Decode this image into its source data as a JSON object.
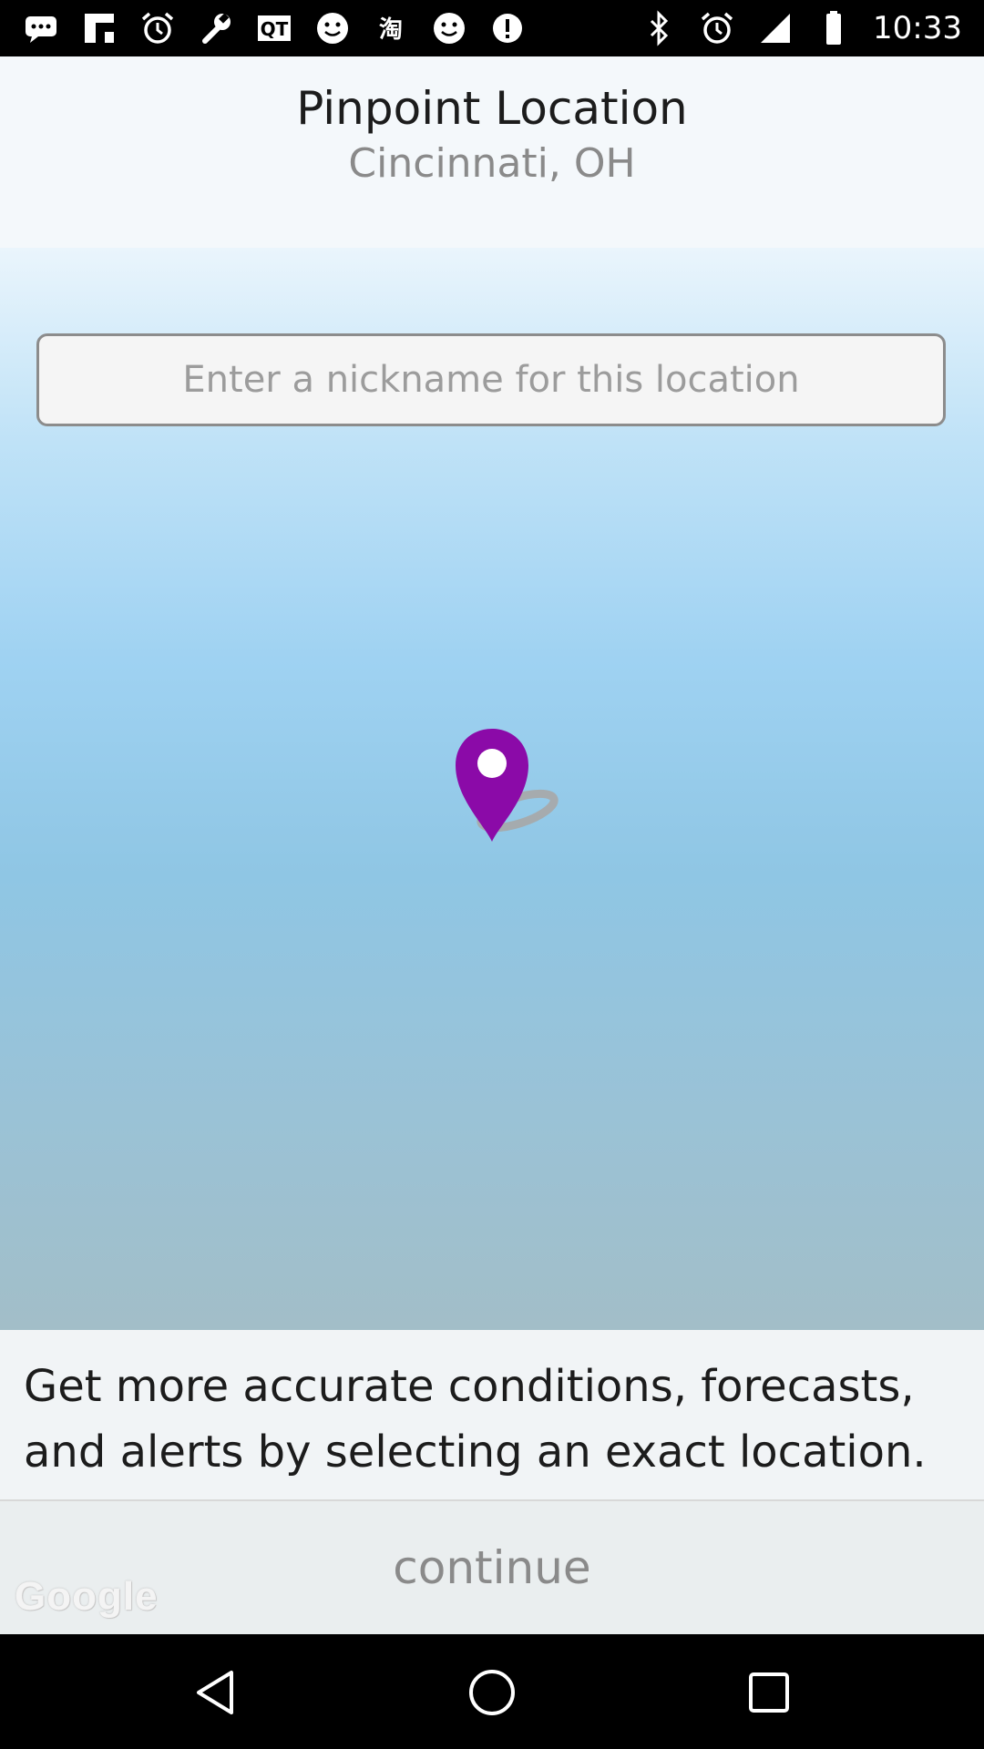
{
  "status_bar": {
    "time": "10:33",
    "left_icons": [
      "messages-icon",
      "flipboard-icon",
      "alarm-icon",
      "wrench-icon",
      "qt-icon",
      "smiley-icon",
      "translate-icon",
      "smiley-icon",
      "info-icon"
    ],
    "right_icons": [
      "bluetooth-icon",
      "alarm-icon",
      "signal-icon",
      "battery-icon"
    ]
  },
  "header": {
    "title": "Pinpoint Location",
    "subtitle": "Cincinnati, OH"
  },
  "nickname_input": {
    "placeholder": "Enter a nickname for this location",
    "value": ""
  },
  "map": {
    "pin_color": "#8b0aa8"
  },
  "info": {
    "text": "Get more accurate conditions, forecasts, and alerts by selecting an exact location."
  },
  "continue": {
    "label": "continue",
    "attribution": "Google"
  },
  "nav": {
    "buttons": [
      "back-icon",
      "home-icon",
      "recents-icon"
    ]
  }
}
